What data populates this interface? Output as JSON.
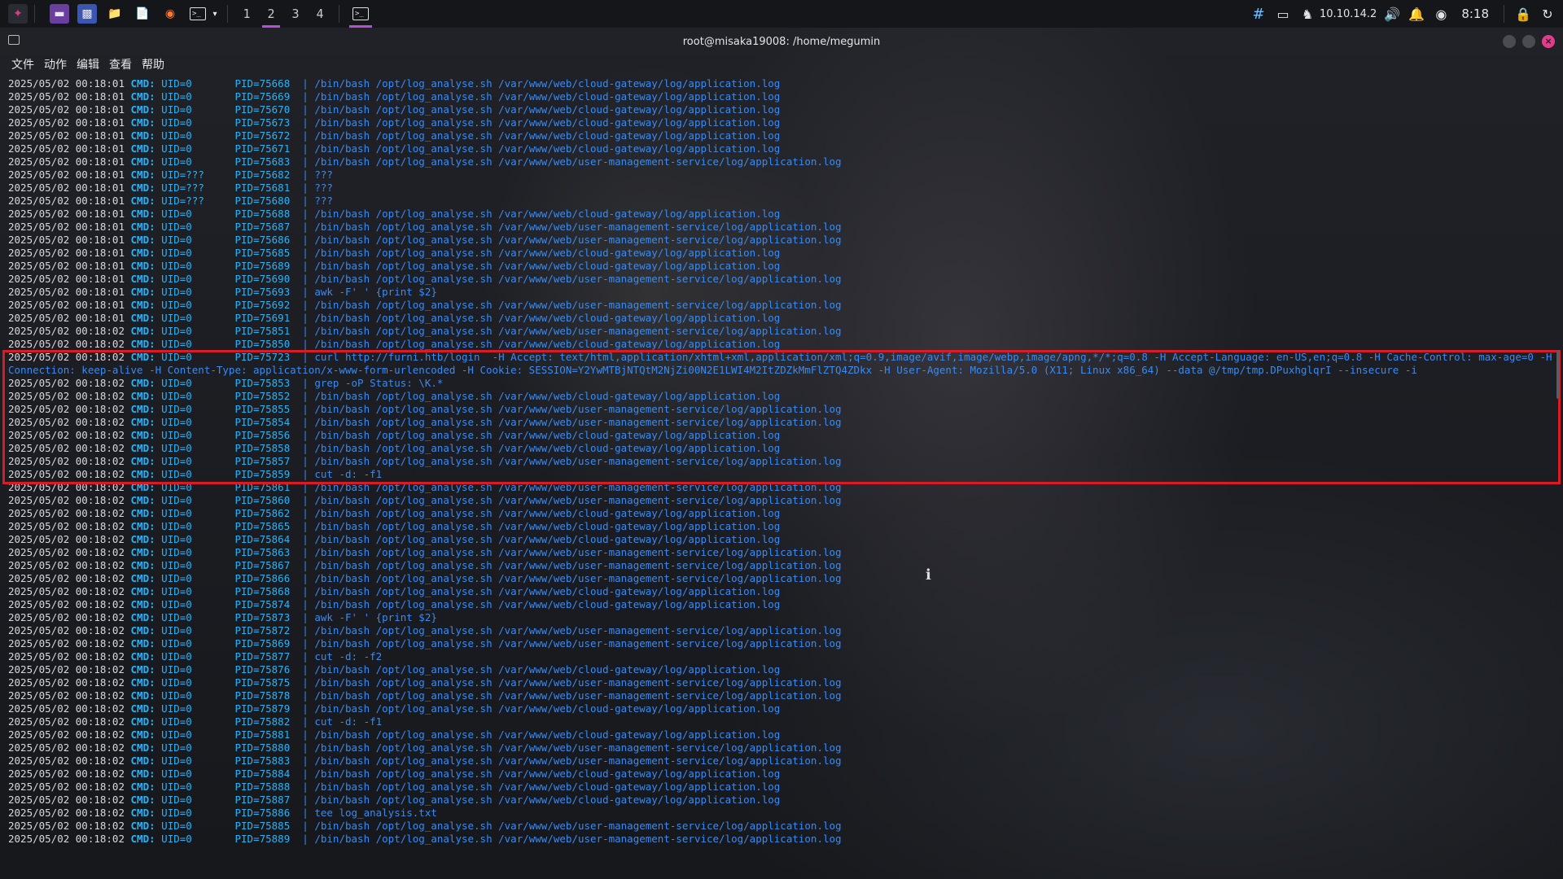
{
  "panel": {
    "workspaces": [
      {
        "label": "1",
        "active": false
      },
      {
        "label": "2",
        "active": true
      },
      {
        "label": "3",
        "active": false
      },
      {
        "label": "4",
        "active": false
      }
    ],
    "ip": "10.10.14.2",
    "clock": "8:18",
    "accent_color": "#b451d6"
  },
  "window": {
    "title": "root@misaka19008: /home/megumin"
  },
  "menu": [
    "文件",
    "动作",
    "编辑",
    "查看",
    "帮助"
  ],
  "log": {
    "lines": [
      {
        "ts": "2025/05/02 00:18:01",
        "uid": "UID=0  ",
        "pid": "PID=75668",
        "cmd": "/bin/bash /opt/log_analyse.sh /var/www/web/cloud-gateway/log/application.log"
      },
      {
        "ts": "2025/05/02 00:18:01",
        "uid": "UID=0  ",
        "pid": "PID=75669",
        "cmd": "/bin/bash /opt/log_analyse.sh /var/www/web/cloud-gateway/log/application.log"
      },
      {
        "ts": "2025/05/02 00:18:01",
        "uid": "UID=0  ",
        "pid": "PID=75670",
        "cmd": "/bin/bash /opt/log_analyse.sh /var/www/web/cloud-gateway/log/application.log"
      },
      {
        "ts": "2025/05/02 00:18:01",
        "uid": "UID=0  ",
        "pid": "PID=75673",
        "cmd": "/bin/bash /opt/log_analyse.sh /var/www/web/cloud-gateway/log/application.log"
      },
      {
        "ts": "2025/05/02 00:18:01",
        "uid": "UID=0  ",
        "pid": "PID=75672",
        "cmd": "/bin/bash /opt/log_analyse.sh /var/www/web/cloud-gateway/log/application.log"
      },
      {
        "ts": "2025/05/02 00:18:01",
        "uid": "UID=0  ",
        "pid": "PID=75671",
        "cmd": "/bin/bash /opt/log_analyse.sh /var/www/web/cloud-gateway/log/application.log"
      },
      {
        "ts": "2025/05/02 00:18:01",
        "uid": "UID=0  ",
        "pid": "PID=75683",
        "cmd": "/bin/bash /opt/log_analyse.sh /var/www/web/user-management-service/log/application.log"
      },
      {
        "ts": "2025/05/02 00:18:01",
        "uid": "UID=???",
        "pid": "PID=75682",
        "cmd": "???"
      },
      {
        "ts": "2025/05/02 00:18:01",
        "uid": "UID=???",
        "pid": "PID=75681",
        "cmd": "???"
      },
      {
        "ts": "2025/05/02 00:18:01",
        "uid": "UID=???",
        "pid": "PID=75680",
        "cmd": "???"
      },
      {
        "ts": "2025/05/02 00:18:01",
        "uid": "UID=0  ",
        "pid": "PID=75688",
        "cmd": "/bin/bash /opt/log_analyse.sh /var/www/web/cloud-gateway/log/application.log"
      },
      {
        "ts": "2025/05/02 00:18:01",
        "uid": "UID=0  ",
        "pid": "PID=75687",
        "cmd": "/bin/bash /opt/log_analyse.sh /var/www/web/user-management-service/log/application.log"
      },
      {
        "ts": "2025/05/02 00:18:01",
        "uid": "UID=0  ",
        "pid": "PID=75686",
        "cmd": "/bin/bash /opt/log_analyse.sh /var/www/web/user-management-service/log/application.log"
      },
      {
        "ts": "2025/05/02 00:18:01",
        "uid": "UID=0  ",
        "pid": "PID=75685",
        "cmd": "/bin/bash /opt/log_analyse.sh /var/www/web/cloud-gateway/log/application.log"
      },
      {
        "ts": "2025/05/02 00:18:01",
        "uid": "UID=0  ",
        "pid": "PID=75689",
        "cmd": "/bin/bash /opt/log_analyse.sh /var/www/web/cloud-gateway/log/application.log"
      },
      {
        "ts": "2025/05/02 00:18:01",
        "uid": "UID=0  ",
        "pid": "PID=75690",
        "cmd": "/bin/bash /opt/log_analyse.sh /var/www/web/user-management-service/log/application.log"
      },
      {
        "ts": "2025/05/02 00:18:01",
        "uid": "UID=0  ",
        "pid": "PID=75693",
        "cmd": "awk -F' ' {print $2}"
      },
      {
        "ts": "2025/05/02 00:18:01",
        "uid": "UID=0  ",
        "pid": "PID=75692",
        "cmd": "/bin/bash /opt/log_analyse.sh /var/www/web/user-management-service/log/application.log"
      },
      {
        "ts": "2025/05/02 00:18:01",
        "uid": "UID=0  ",
        "pid": "PID=75691",
        "cmd": "/bin/bash /opt/log_analyse.sh /var/www/web/cloud-gateway/log/application.log"
      },
      {
        "ts": "2025/05/02 00:18:02",
        "uid": "UID=0  ",
        "pid": "PID=75851",
        "cmd": "/bin/bash /opt/log_analyse.sh /var/www/web/user-management-service/log/application.log"
      },
      {
        "ts": "2025/05/02 00:18:02",
        "uid": "UID=0  ",
        "pid": "PID=75850",
        "cmd": "/bin/bash /opt/log_analyse.sh /var/www/web/cloud-gateway/log/application.log"
      },
      {
        "ts": "2025/05/02 00:18:02",
        "uid": "UID=0  ",
        "pid": "PID=75723",
        "cmd": "curl http://furni.htb/login  -H Accept: text/html,application/xhtml+xml,application/xml;q=0.9,image/avif,image/webp,image/apng,*/*;q=0.8 -H Accept-Language: en-US,en;q=0.8 -H Cache-Control: max-age=0 -H Connection: keep-alive -H Content-Type: application/x-www-form-urlencoded -H Cookie: SESSION=Y2YwMTBjNTQtM2NjZi00N2E1LWI4M2ItZDZkMmFlZTQ4ZDkx -H User-Agent: Mozilla/5.0 (X11; Linux x86_64) --data @/tmp/tmp.DPuxhglqrI --insecure -i",
        "wrap": true
      },
      {
        "ts": "2025/05/02 00:18:02",
        "uid": "UID=0  ",
        "pid": "PID=75853",
        "cmd": "grep -oP Status: \\K.*"
      },
      {
        "ts": "2025/05/02 00:18:02",
        "uid": "UID=0  ",
        "pid": "PID=75852",
        "cmd": "/bin/bash /opt/log_analyse.sh /var/www/web/cloud-gateway/log/application.log"
      },
      {
        "ts": "2025/05/02 00:18:02",
        "uid": "UID=0  ",
        "pid": "PID=75855",
        "cmd": "/bin/bash /opt/log_analyse.sh /var/www/web/user-management-service/log/application.log"
      },
      {
        "ts": "2025/05/02 00:18:02",
        "uid": "UID=0  ",
        "pid": "PID=75854",
        "cmd": "/bin/bash /opt/log_analyse.sh /var/www/web/user-management-service/log/application.log"
      },
      {
        "ts": "2025/05/02 00:18:02",
        "uid": "UID=0  ",
        "pid": "PID=75856",
        "cmd": "/bin/bash /opt/log_analyse.sh /var/www/web/cloud-gateway/log/application.log"
      },
      {
        "ts": "2025/05/02 00:18:02",
        "uid": "UID=0  ",
        "pid": "PID=75858",
        "cmd": "/bin/bash /opt/log_analyse.sh /var/www/web/cloud-gateway/log/application.log"
      },
      {
        "ts": "2025/05/02 00:18:02",
        "uid": "UID=0  ",
        "pid": "PID=75857",
        "cmd": "/bin/bash /opt/log_analyse.sh /var/www/web/user-management-service/log/application.log"
      },
      {
        "ts": "2025/05/02 00:18:02",
        "uid": "UID=0  ",
        "pid": "PID=75859",
        "cmd": "cut -d: -f1"
      },
      {
        "ts": "2025/05/02 00:18:02",
        "uid": "UID=0  ",
        "pid": "PID=75861",
        "cmd": "/bin/bash /opt/log_analyse.sh /var/www/web/user-management-service/log/application.log"
      },
      {
        "ts": "2025/05/02 00:18:02",
        "uid": "UID=0  ",
        "pid": "PID=75860",
        "cmd": "/bin/bash /opt/log_analyse.sh /var/www/web/user-management-service/log/application.log"
      },
      {
        "ts": "2025/05/02 00:18:02",
        "uid": "UID=0  ",
        "pid": "PID=75862",
        "cmd": "/bin/bash /opt/log_analyse.sh /var/www/web/cloud-gateway/log/application.log"
      },
      {
        "ts": "2025/05/02 00:18:02",
        "uid": "UID=0  ",
        "pid": "PID=75865",
        "cmd": "/bin/bash /opt/log_analyse.sh /var/www/web/cloud-gateway/log/application.log"
      },
      {
        "ts": "2025/05/02 00:18:02",
        "uid": "UID=0  ",
        "pid": "PID=75864",
        "cmd": "/bin/bash /opt/log_analyse.sh /var/www/web/cloud-gateway/log/application.log"
      },
      {
        "ts": "2025/05/02 00:18:02",
        "uid": "UID=0  ",
        "pid": "PID=75863",
        "cmd": "/bin/bash /opt/log_analyse.sh /var/www/web/user-management-service/log/application.log"
      },
      {
        "ts": "2025/05/02 00:18:02",
        "uid": "UID=0  ",
        "pid": "PID=75867",
        "cmd": "/bin/bash /opt/log_analyse.sh /var/www/web/user-management-service/log/application.log"
      },
      {
        "ts": "2025/05/02 00:18:02",
        "uid": "UID=0  ",
        "pid": "PID=75866",
        "cmd": "/bin/bash /opt/log_analyse.sh /var/www/web/user-management-service/log/application.log"
      },
      {
        "ts": "2025/05/02 00:18:02",
        "uid": "UID=0  ",
        "pid": "PID=75868",
        "cmd": "/bin/bash /opt/log_analyse.sh /var/www/web/cloud-gateway/log/application.log"
      },
      {
        "ts": "2025/05/02 00:18:02",
        "uid": "UID=0  ",
        "pid": "PID=75874",
        "cmd": "/bin/bash /opt/log_analyse.sh /var/www/web/cloud-gateway/log/application.log"
      },
      {
        "ts": "2025/05/02 00:18:02",
        "uid": "UID=0  ",
        "pid": "PID=75873",
        "cmd": "awk -F' ' {print $2}"
      },
      {
        "ts": "2025/05/02 00:18:02",
        "uid": "UID=0  ",
        "pid": "PID=75872",
        "cmd": "/bin/bash /opt/log_analyse.sh /var/www/web/user-management-service/log/application.log"
      },
      {
        "ts": "2025/05/02 00:18:02",
        "uid": "UID=0  ",
        "pid": "PID=75869",
        "cmd": "/bin/bash /opt/log_analyse.sh /var/www/web/user-management-service/log/application.log"
      },
      {
        "ts": "2025/05/02 00:18:02",
        "uid": "UID=0  ",
        "pid": "PID=75877",
        "cmd": "cut -d: -f2"
      },
      {
        "ts": "2025/05/02 00:18:02",
        "uid": "UID=0  ",
        "pid": "PID=75876",
        "cmd": "/bin/bash /opt/log_analyse.sh /var/www/web/cloud-gateway/log/application.log"
      },
      {
        "ts": "2025/05/02 00:18:02",
        "uid": "UID=0  ",
        "pid": "PID=75875",
        "cmd": "/bin/bash /opt/log_analyse.sh /var/www/web/user-management-service/log/application.log"
      },
      {
        "ts": "2025/05/02 00:18:02",
        "uid": "UID=0  ",
        "pid": "PID=75878",
        "cmd": "/bin/bash /opt/log_analyse.sh /var/www/web/user-management-service/log/application.log"
      },
      {
        "ts": "2025/05/02 00:18:02",
        "uid": "UID=0  ",
        "pid": "PID=75879",
        "cmd": "/bin/bash /opt/log_analyse.sh /var/www/web/cloud-gateway/log/application.log"
      },
      {
        "ts": "2025/05/02 00:18:02",
        "uid": "UID=0  ",
        "pid": "PID=75882",
        "cmd": "cut -d: -f1"
      },
      {
        "ts": "2025/05/02 00:18:02",
        "uid": "UID=0  ",
        "pid": "PID=75881",
        "cmd": "/bin/bash /opt/log_analyse.sh /var/www/web/cloud-gateway/log/application.log"
      },
      {
        "ts": "2025/05/02 00:18:02",
        "uid": "UID=0  ",
        "pid": "PID=75880",
        "cmd": "/bin/bash /opt/log_analyse.sh /var/www/web/user-management-service/log/application.log"
      },
      {
        "ts": "2025/05/02 00:18:02",
        "uid": "UID=0  ",
        "pid": "PID=75883",
        "cmd": "/bin/bash /opt/log_analyse.sh /var/www/web/user-management-service/log/application.log"
      },
      {
        "ts": "2025/05/02 00:18:02",
        "uid": "UID=0  ",
        "pid": "PID=75884",
        "cmd": "/bin/bash /opt/log_analyse.sh /var/www/web/cloud-gateway/log/application.log"
      },
      {
        "ts": "2025/05/02 00:18:02",
        "uid": "UID=0  ",
        "pid": "PID=75888",
        "cmd": "/bin/bash /opt/log_analyse.sh /var/www/web/cloud-gateway/log/application.log"
      },
      {
        "ts": "2025/05/02 00:18:02",
        "uid": "UID=0  ",
        "pid": "PID=75887",
        "cmd": "/bin/bash /opt/log_analyse.sh /var/www/web/cloud-gateway/log/application.log"
      },
      {
        "ts": "2025/05/02 00:18:02",
        "uid": "UID=0  ",
        "pid": "PID=75886",
        "cmd": "tee log_analysis.txt"
      },
      {
        "ts": "2025/05/02 00:18:02",
        "uid": "UID=0  ",
        "pid": "PID=75885",
        "cmd": "/bin/bash /opt/log_analyse.sh /var/www/web/user-management-service/log/application.log"
      },
      {
        "ts": "2025/05/02 00:18:02",
        "uid": "UID=0  ",
        "pid": "PID=75889",
        "cmd": "/bin/bash /opt/log_analyse.sh /var/www/web/user-management-service/log/application.log"
      }
    ],
    "cmd_label": "CMD:",
    "separator": "|",
    "highlight_color": "#d81b24"
  }
}
